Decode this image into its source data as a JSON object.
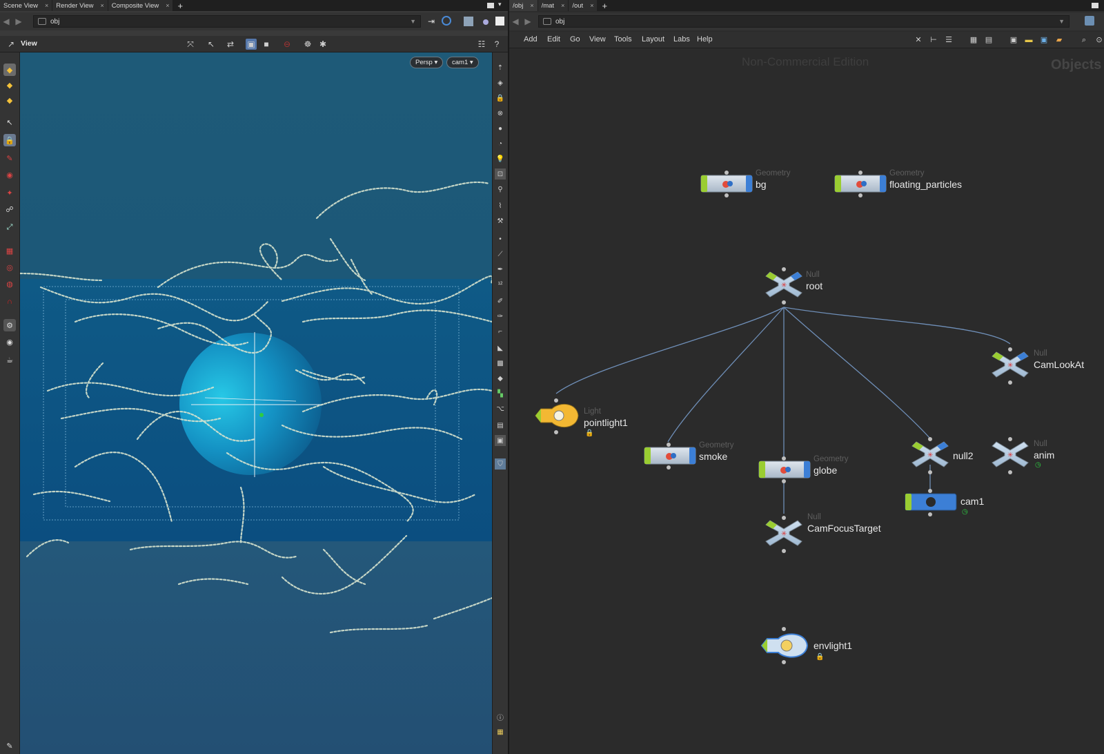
{
  "left_pane": {
    "tabs": [
      {
        "label": "Scene View",
        "close": "×"
      },
      {
        "label": "Render View",
        "close": "×"
      },
      {
        "label": "Composite View",
        "close": "×"
      }
    ],
    "tab_add": "+",
    "path": "obj",
    "view_label": "View",
    "viewport": {
      "projection_button": "Persp ▾",
      "camera_button": "cam1 ▾"
    }
  },
  "right_pane": {
    "tabs": [
      {
        "label": "/obj",
        "close": "×"
      },
      {
        "label": "/mat",
        "close": "×"
      },
      {
        "label": "/out",
        "close": "×"
      }
    ],
    "tab_add": "+",
    "path": "obj",
    "menu": [
      "Add",
      "Edit",
      "Go",
      "View",
      "Tools",
      "Layout",
      "Labs",
      "Help"
    ],
    "watermark": "Non-Commercial Edition",
    "context_label": "Objects",
    "nodes": {
      "bg": {
        "type": "Geometry",
        "name": "bg"
      },
      "floating_particles": {
        "type": "Geometry",
        "name": "floating_particles"
      },
      "root": {
        "type": "Null",
        "name": "root"
      },
      "camlookat": {
        "type": "Null",
        "name": "CamLookAt"
      },
      "pointlight1": {
        "type": "Light",
        "name": "pointlight1"
      },
      "smoke": {
        "type": "Geometry",
        "name": "smoke"
      },
      "globe": {
        "type": "Geometry",
        "name": "globe"
      },
      "null2": {
        "type": "",
        "name": "null2"
      },
      "anim": {
        "type": "Null",
        "name": "anim"
      },
      "cam1": {
        "type": "",
        "name": "cam1"
      },
      "camfocustarget": {
        "type": "Null",
        "name": "CamFocusTarget"
      },
      "envlight1": {
        "type": "",
        "name": "envlight1"
      }
    }
  },
  "colors": {
    "geo_green": "#9acd32",
    "geo_blue": "#3c7fd6",
    "light_yellow": "#f3b833",
    "null_blue": "#b7cfe6",
    "wire": "#6f8fb8",
    "viewport_bg": "#1f5b78"
  }
}
